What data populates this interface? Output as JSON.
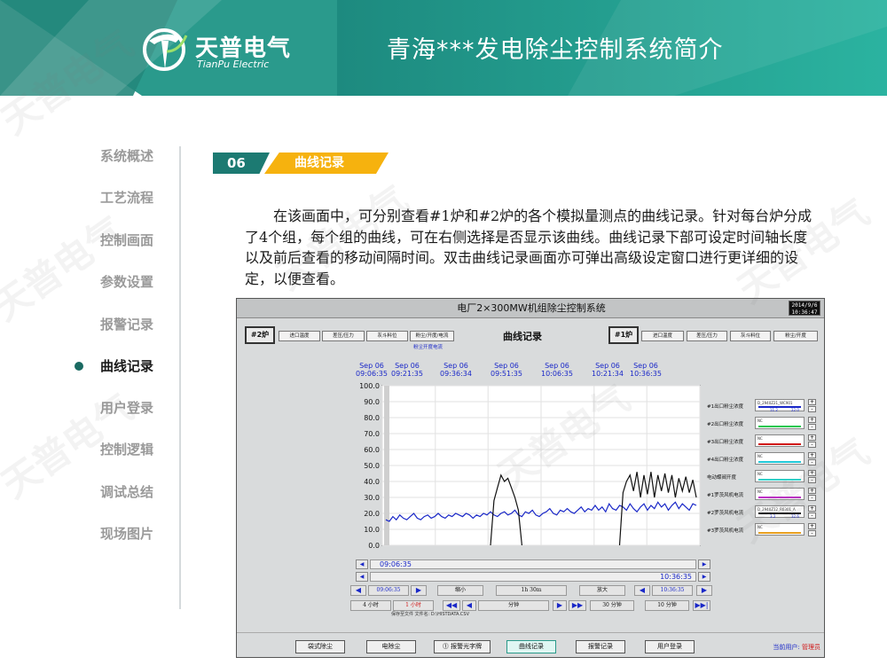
{
  "header": {
    "logo_cn": "天普电气",
    "logo_en": "TianPu Electric",
    "title": "青海***发电除尘控制系统简介"
  },
  "nav": {
    "items": [
      {
        "label": "系统概述"
      },
      {
        "label": "工艺流程"
      },
      {
        "label": "控制画面"
      },
      {
        "label": "参数设置"
      },
      {
        "label": "报警记录"
      },
      {
        "label": "曲线记录",
        "active": true
      },
      {
        "label": "用户登录"
      },
      {
        "label": "控制逻辑"
      },
      {
        "label": "调试总结"
      },
      {
        "label": "现场图片"
      }
    ]
  },
  "section": {
    "number": "06",
    "label": "曲线记录",
    "description": "在该画面中，可分别查看#1炉和#2炉的各个模拟量测点的曲线记录。针对每台炉分成了4个组，每个组的曲线，可在右侧选择是否显示该曲线。曲线记录下部可设定时间轴长度以及前后查看的移动间隔时间。双击曲线记录画面亦可弹出高级设定窗口进行更详细的设定，以便查看。"
  },
  "scada": {
    "window_title": "电厂2×300MW机组除尘控制系统",
    "clock_date": "2014/9/6",
    "clock_time": "10:36:47",
    "left_furnace": "#2炉",
    "right_furnace": "#1炉",
    "curve_title": "曲线记录",
    "left_groups": [
      "进口温度",
      "差压/压力",
      "灰斗料位",
      "粉尘/开度/电流"
    ],
    "right_groups": [
      "进口温度",
      "差压/压力",
      "灰斗料位",
      "粉尘/开度"
    ],
    "subtitle": "粉尘开度电流",
    "time_headers": [
      {
        "date": "Sep 06",
        "time": "09:06:35"
      },
      {
        "date": "Sep 06",
        "time": "09:21:35"
      },
      {
        "date": "Sep 06",
        "time": "09:36:34"
      },
      {
        "date": "Sep 06",
        "time": "09:51:35"
      },
      {
        "date": "Sep 06",
        "time": "10:06:35"
      },
      {
        "date": "Sep 06",
        "time": "10:21:34"
      },
      {
        "date": "Sep 06",
        "time": "10:36:35"
      }
    ],
    "legend": [
      {
        "label": "#1出口粉尘浓度",
        "box": "D_2940Z21_WC901",
        "v1": "11.2",
        "v2": "22.0",
        "color": "#1a28c8"
      },
      {
        "label": "#2出口粉尘浓度",
        "box": "NC",
        "color": "#1ec850"
      },
      {
        "label": "#3出口粉尘浓度",
        "box": "NC",
        "color": "#d01818"
      },
      {
        "label": "#4出口粉尘浓度",
        "box": "NC",
        "color": "#20c8d8"
      },
      {
        "label": "电动蝶阀开度",
        "box": "NC",
        "color": "#30d0c8"
      },
      {
        "label": "#1罗茨风机电流",
        "box": "NC",
        "color": "#c030c8"
      },
      {
        "label": "#2罗茨风机电流",
        "box": "D_2940Z12_R0301_A",
        "v1": "3.2",
        "v2": "32.6",
        "color": "#111111"
      },
      {
        "label": "#3罗茨风机电流",
        "box": "NC",
        "color": "#e8a020"
      }
    ],
    "scroll_start": "09:06:35",
    "scroll_end": "10:36:35",
    "ctrl": {
      "start": "09:06:35",
      "zoom_out": "缩小",
      "span": "1h 30m",
      "zoom_in": "放大",
      "end": "10:36:35",
      "preset_4h": "4 小时",
      "preset_1h": "1 小时",
      "step_left": "分钟",
      "step_30": "30 分钟",
      "step_10": "10 分钟"
    },
    "file_row": "保存至文件   文件名:  D:\\HISTDATA.CSV",
    "bottom_buttons": [
      "袋式除尘",
      "电除尘",
      "报警光字牌",
      "曲线记录",
      "报警记录",
      "用户登录"
    ],
    "current_user_label": "当前用户:",
    "current_user": "管理员"
  },
  "chart_data": {
    "type": "line",
    "ylim": [
      0,
      100
    ],
    "yticks": [
      0,
      10,
      20,
      30,
      40,
      50,
      60,
      70,
      80,
      90,
      100
    ],
    "x_start": "09:06:35",
    "x_end": "10:36:35",
    "series": [
      {
        "name": "#1出口粉尘浓度",
        "color": "#1a28c8",
        "values": [
          16,
          15,
          18,
          16,
          19,
          17,
          16,
          18,
          20,
          17,
          16,
          18,
          19,
          17,
          18,
          20,
          18,
          17,
          19,
          18,
          20,
          19,
          18,
          20,
          19,
          17,
          19,
          18,
          20,
          19,
          21,
          19,
          18,
          20,
          21,
          19,
          20,
          22,
          19,
          18,
          21,
          20,
          22,
          19,
          18,
          20,
          21,
          23,
          20,
          19,
          22,
          21,
          23,
          21,
          20,
          22,
          24,
          21,
          23,
          22,
          25,
          22,
          24,
          21,
          26,
          23,
          22,
          25,
          24,
          22,
          26,
          23,
          21,
          24,
          26,
          22,
          25,
          23,
          27,
          24,
          26,
          22,
          25,
          27,
          23,
          26,
          24,
          22,
          26,
          25
        ]
      },
      {
        "name": "#2罗茨风机电流",
        "color": "#111111",
        "values": [
          null,
          null,
          null,
          null,
          null,
          null,
          null,
          null,
          null,
          null,
          null,
          null,
          null,
          null,
          null,
          null,
          null,
          null,
          null,
          null,
          null,
          null,
          null,
          null,
          null,
          null,
          null,
          null,
          null,
          null,
          0,
          28,
          36,
          44,
          40,
          42,
          36,
          30,
          22,
          0,
          null,
          null,
          null,
          null,
          null,
          null,
          null,
          null,
          null,
          null,
          null,
          null,
          null,
          null,
          null,
          null,
          null,
          null,
          null,
          null,
          null,
          null,
          null,
          null,
          null,
          null,
          null,
          0,
          33,
          40,
          44,
          34,
          46,
          30,
          44,
          32,
          46,
          30,
          44,
          34,
          45,
          33,
          44,
          30,
          42,
          34,
          43,
          33,
          41,
          30
        ]
      }
    ]
  }
}
